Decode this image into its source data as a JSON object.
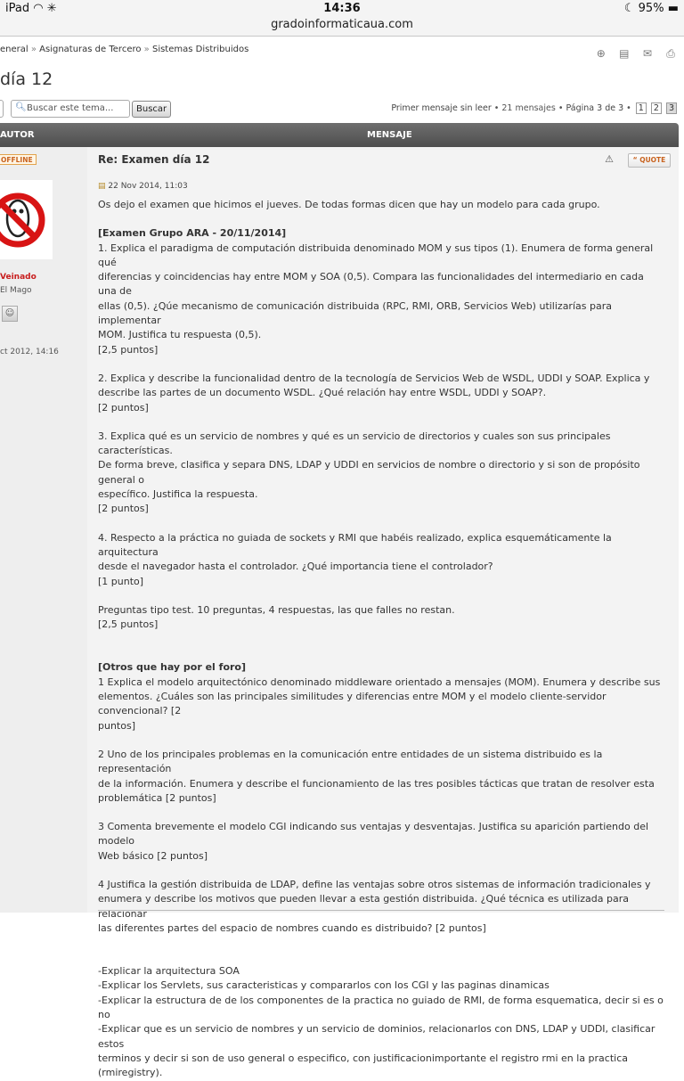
{
  "status_bar": {
    "device": "iPad",
    "time": "14:36",
    "battery": "95%"
  },
  "browser": {
    "url": "gradoinformaticaua.com"
  },
  "breadcrumb": [
    "eneral",
    "Asignaturas de Tercero",
    "Sistemas Distribuidos"
  ],
  "topic": {
    "title": "día 12"
  },
  "search": {
    "placeholder": "Buscar este tema...",
    "button": "Buscar"
  },
  "pagination": {
    "first_unread": "Primer mensaje sin leer",
    "messages": "21 mensajes",
    "page_info": "Página 3 de 3",
    "pages": [
      "1",
      "2",
      "3"
    ]
  },
  "table_header": {
    "author": "AUTOR",
    "message": "MENSAJE"
  },
  "author": {
    "status": "OFFLINE",
    "username": "Veinado",
    "rank": "El Mago",
    "joined": "ct 2012, 14:16"
  },
  "post": {
    "subject": "Re: Examen día 12",
    "quote_label": "QUOTE",
    "date": "22 Nov 2014, 11:03",
    "intro": "Os dejo el examen que hicimos el jueves. De todas formas dicen que hay un modelo para cada grupo.",
    "exam_heading": "[Examen Grupo ARA - 20/11/2014]",
    "exam_items": [
      "1. Explica el paradigma de computación distribuida denominado MOM y sus tipos (1). Enumera de forma general qué\ndiferencias y coincidencias hay entre MOM y SOA (0,5). Compara las funcionalidades del intermediario en cada una de\nellas (0,5). ¿Qúe mecanismo de comunicación distribuida (RPC, RMI, ORB, Servicios Web) utilizarías para implementar\nMOM. Justifica tu respuesta (0,5).\n[2,5 puntos]",
      "2. Explica y describe la funcionalidad dentro de la tecnología de Servicios Web de WSDL, UDDI y SOAP. Explica y\ndescribe las partes de un documento WSDL. ¿Qué relación hay entre WSDL, UDDI y SOAP?.\n[2 puntos]",
      "3. Explica qué es un servicio de nombres y qué es un servicio de directorios y cuales son sus principales características.\nDe forma breve, clasifica y separa DNS, LDAP y UDDI en servicios de nombre o directorio y si son de propósito general o\nespecífico. Justifica la respuesta.\n[2 puntos]",
      "4. Respecto a la práctica no guiada de sockets y RMI que habéis realizado, explica esquemáticamente la arquitectura\ndesde el navegador hasta el controlador. ¿Qué importancia tiene el controlador?\n[1 punto]",
      "Preguntas tipo test. 10 preguntas, 4 respuestas, las que falles no restan.\n[2,5 puntos]"
    ],
    "others_heading": "[Otros que hay por el foro]",
    "others_items": [
      "1 Explica el modelo arquitectónico denominado middleware orientado a mensajes (MOM). Enumera y describe sus\nelementos. ¿Cuáles son las principales similitudes y diferencias entre MOM y el modelo cliente-servidor convencional? [2\npuntos]",
      "2 Uno de los principales problemas en la comunicación entre entidades de un sistema distribuido es la representación\nde la información. Enumera y describe el funcionamiento de las tres posibles tácticas que tratan de resolver esta\nproblemática [2 puntos]",
      "3 Comenta brevemente el modelo CGI indicando sus ventajas y desventajas. Justifica su aparición partiendo del modelo\nWeb básico [2 puntos]",
      "4 Justifica la gestión distribuida de LDAP, define las ventajas sobre otros sistemas de información tradicionales y\nenumera y describe los motivos que pueden llevar a esta gestión distribuida. ¿Qué técnica es utilizada para relacionar\nlas diferentes partes del espacio de nombres cuando es distribuido? [2 puntos]"
    ],
    "list_items": [
      "-Explicar la arquitectura SOA",
      "-Explicar los Servlets, sus caracteristicas y compararlos con los CGI y las paginas dinamicas",
      "-Explicar la estructura de de los componentes de la practica no guiado de RMI, de forma esquematica, decir si es o no",
      "-Explicar que es un servicio de nombres y un servicio de dominios, relacionarlos con DNS, LDAP y UDDI, clasificar estos\nterminos y decir si son de uso general o especifico, con justificacionimportante el registro rmi en la practica\n(rmiregistry)."
    ]
  }
}
